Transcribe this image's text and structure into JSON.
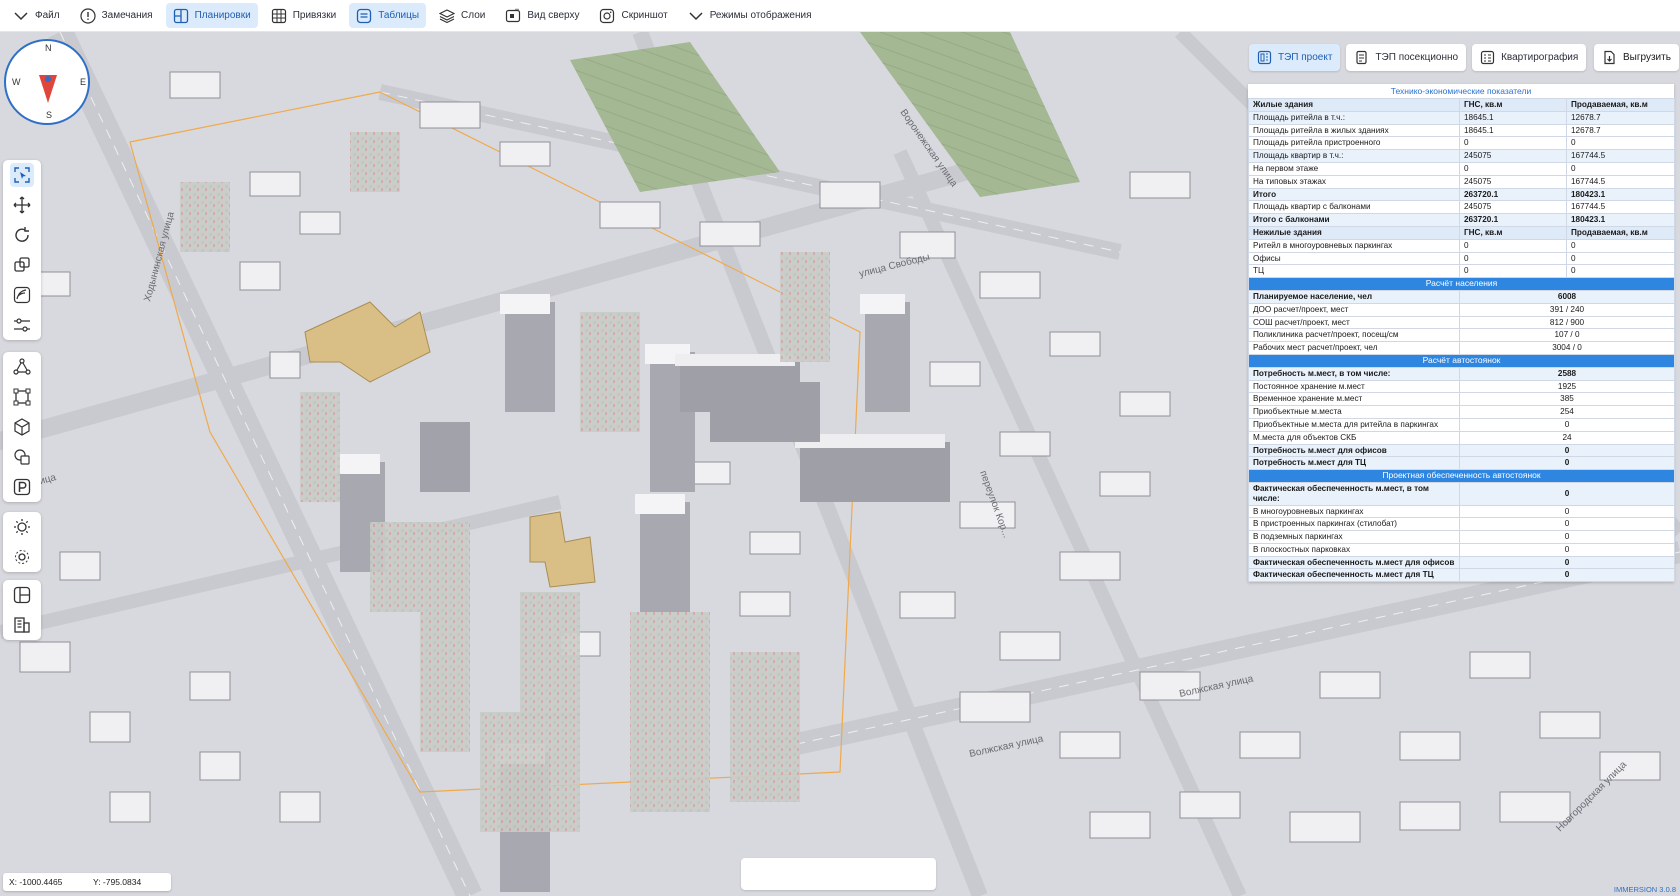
{
  "toolbar": {
    "items": [
      {
        "label": "Файл",
        "icon": "chevron-down-icon"
      },
      {
        "label": "Замечания",
        "icon": "alert-icon"
      },
      {
        "label": "Планировки",
        "icon": "layout-icon",
        "active": true
      },
      {
        "label": "Привязки",
        "icon": "grid-icon"
      },
      {
        "label": "Таблицы",
        "icon": "table-icon",
        "active": true
      },
      {
        "label": "Слои",
        "icon": "layers-icon"
      },
      {
        "label": "Вид сверху",
        "icon": "top-view-icon"
      },
      {
        "label": "Скриншот",
        "icon": "camera-icon"
      },
      {
        "label": "Режимы отображения",
        "icon": "chevron-down-icon"
      }
    ]
  },
  "compass": {
    "n": "N",
    "s": "S",
    "w": "W",
    "e": "E"
  },
  "palette_icons": {
    "group1": [
      "select-icon",
      "move-icon",
      "rotate-icon",
      "copy-icon",
      "path-icon",
      "settings-sliders-icon"
    ],
    "group2": [
      "nodes-icon",
      "frame-icon",
      "cube-icon",
      "shapes-icon",
      "parking-icon"
    ],
    "group3": [
      "sun-icon",
      "sun-settings-icon"
    ],
    "group4": [
      "plan-icon",
      "building-icon"
    ]
  },
  "right_tabs": [
    {
      "label": "ТЭП проект",
      "icon": "tep-project-icon",
      "active": true
    },
    {
      "label": "ТЭП посекционно",
      "icon": "tep-section-icon"
    },
    {
      "label": "Квартирография",
      "icon": "apartments-icon"
    }
  ],
  "export_label": "Выгрузить",
  "tep": {
    "caption": "Технико-экономические показатели",
    "living_header": [
      "Жилые здания",
      "ГНС, кв.м",
      "Продаваемая, кв.м"
    ],
    "living_rows": [
      {
        "label": "Площадь ритейла в т.ч.:",
        "gns": "18645.1",
        "sale": "12678.7",
        "style": "hl"
      },
      {
        "label": "Площадь ритейла в жилых зданиях",
        "gns": "18645.1",
        "sale": "12678.7"
      },
      {
        "label": "Площадь ритейла пристроенного",
        "gns": "0",
        "sale": "0"
      },
      {
        "label": "Площадь квартир в т.ч.:",
        "gns": "245075",
        "sale": "167744.5",
        "style": "hl"
      },
      {
        "label": "На первом этаже",
        "gns": "0",
        "sale": "0"
      },
      {
        "label": "На типовых этажах",
        "gns": "245075",
        "sale": "167744.5"
      },
      {
        "label": "Итого",
        "gns": "263720.1",
        "sale": "180423.1",
        "style": "hlb"
      },
      {
        "label": "Площадь квартир с балконами",
        "gns": "245075",
        "sale": "167744.5"
      },
      {
        "label": "Итого с балконами",
        "gns": "263720.1",
        "sale": "180423.1",
        "style": "hlb"
      }
    ],
    "nonliving_header": [
      "Нежилые здания",
      "ГНС, кв.м",
      "Продаваемая, кв.м"
    ],
    "nonliving_rows": [
      {
        "label": "Ритейл в многоуровневых паркингах",
        "gns": "0",
        "sale": "0"
      },
      {
        "label": "Офисы",
        "gns": "0",
        "sale": "0"
      },
      {
        "label": "ТЦ",
        "gns": "0",
        "sale": "0"
      }
    ],
    "population_title": "Расчёт населения",
    "population_rows": [
      {
        "label": "Планируемое население, чел",
        "value": "6008",
        "style": "hlb"
      },
      {
        "label": "ДОО расчет/проект, мест",
        "value": "391 / 240"
      },
      {
        "label": "СОШ расчет/проект, мест",
        "value": "812 / 900"
      },
      {
        "label": "Поликлиника расчет/проект, посещ/см",
        "value": "107 / 0"
      },
      {
        "label": "Рабочих мест расчет/проект, чел",
        "value": "3004 / 0"
      }
    ],
    "parking_title": "Расчёт автостоянок",
    "parking_rows": [
      {
        "label": "Потребность м.мест, в том числе:",
        "value": "2588",
        "style": "hlb"
      },
      {
        "label": "Постоянное хранение м.мест",
        "value": "1925"
      },
      {
        "label": "Временное хранение м.мест",
        "value": "385"
      },
      {
        "label": "Приобъектные м.места",
        "value": "254"
      },
      {
        "label": "Приобъектные м.места для ритейла в паркингах",
        "value": "0"
      },
      {
        "label": "М.места для объектов СКБ",
        "value": "24"
      },
      {
        "label": "Потребность м.мест для офисов",
        "value": "0",
        "style": "hlb"
      },
      {
        "label": "Потребность м.мест для ТЦ",
        "value": "0",
        "style": "hlb"
      }
    ],
    "supply_title": "Проектная обеспеченность автостоянок",
    "supply_rows": [
      {
        "label": "Фактическая обеспеченность м.мест, в том числе:",
        "value": "0",
        "style": "hlb"
      },
      {
        "label": "В многоуровневых паркингах",
        "value": "0"
      },
      {
        "label": "В пристроенных паркингах (стилобат)",
        "value": "0"
      },
      {
        "label": "В подземных паркингах",
        "value": "0"
      },
      {
        "label": "В плоскостных парковках",
        "value": "0"
      },
      {
        "label": "Фактическая обеспеченность м.мест для офисов",
        "value": "0",
        "style": "hlb"
      },
      {
        "label": "Фактическая обеспеченность м.мест для ТЦ",
        "value": "0",
        "style": "hlb"
      }
    ]
  },
  "map": {
    "street_labels": [
      "Воронежская улица",
      "Волжская улица",
      "Волжская улица",
      "улица Свободы",
      "переулок Кор...",
      "Ходынинская улица",
      "Новгородская улица",
      "улица"
    ],
    "colors": {
      "ground": "#d6d7dc",
      "building_top": "#f2f2f4",
      "building_side": "#9a9ba3",
      "park": "#9fb48f",
      "tan": "#d9bf86",
      "outline": "#f0a94a"
    }
  },
  "coords": {
    "x": "X: -1000.4465",
    "y": "Y: -795.0834"
  },
  "version": "IMMERSION 3.0.8"
}
